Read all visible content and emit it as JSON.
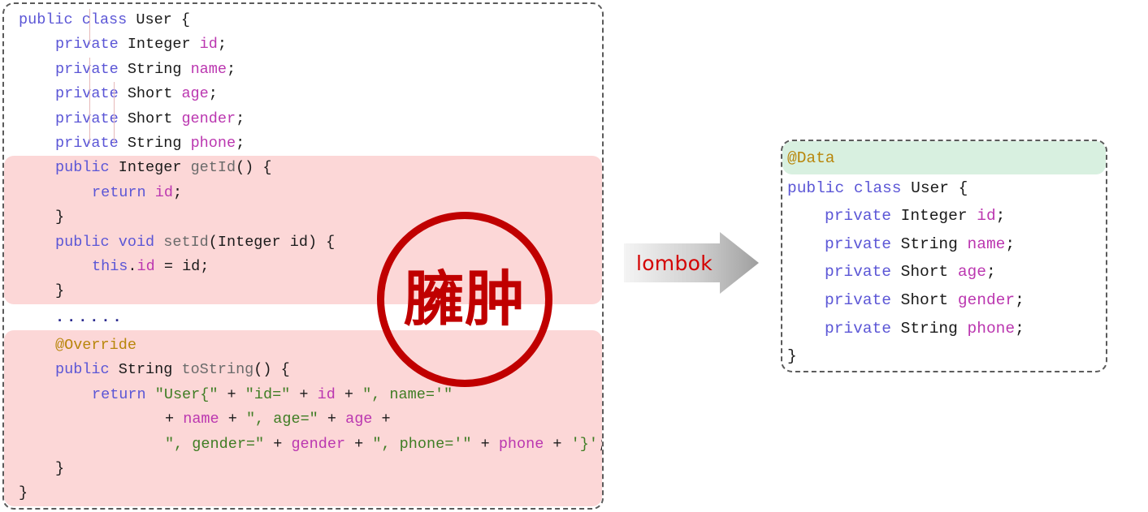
{
  "verbose_panel": {
    "name": "verbose-java-class",
    "highlight_color": "#fcd7d7",
    "lines": [
      {
        "indent": 0,
        "tokens": [
          {
            "t": "public",
            "c": "kw"
          },
          {
            "t": " ",
            "c": "pun"
          },
          {
            "t": "class",
            "c": "kw"
          },
          {
            "t": " ",
            "c": "pun"
          },
          {
            "t": "User",
            "c": "typ"
          },
          {
            "t": " {",
            "c": "pun"
          }
        ]
      },
      {
        "indent": 1,
        "tokens": [
          {
            "t": "private",
            "c": "kw"
          },
          {
            "t": " ",
            "c": "pun"
          },
          {
            "t": "Integer",
            "c": "typ"
          },
          {
            "t": " ",
            "c": "pun"
          },
          {
            "t": "id",
            "c": "fld"
          },
          {
            "t": ";",
            "c": "pun"
          }
        ]
      },
      {
        "indent": 1,
        "tokens": [
          {
            "t": "private",
            "c": "kw"
          },
          {
            "t": " ",
            "c": "pun"
          },
          {
            "t": "String",
            "c": "typ"
          },
          {
            "t": " ",
            "c": "pun"
          },
          {
            "t": "name",
            "c": "fld"
          },
          {
            "t": ";",
            "c": "pun"
          }
        ]
      },
      {
        "indent": 1,
        "tokens": [
          {
            "t": "private",
            "c": "kw"
          },
          {
            "t": " ",
            "c": "pun"
          },
          {
            "t": "Short",
            "c": "typ"
          },
          {
            "t": " ",
            "c": "pun"
          },
          {
            "t": "age",
            "c": "fld"
          },
          {
            "t": ";",
            "c": "pun"
          }
        ]
      },
      {
        "indent": 1,
        "tokens": [
          {
            "t": "private",
            "c": "kw"
          },
          {
            "t": " ",
            "c": "pun"
          },
          {
            "t": "Short",
            "c": "typ"
          },
          {
            "t": " ",
            "c": "pun"
          },
          {
            "t": "gender",
            "c": "fld"
          },
          {
            "t": ";",
            "c": "pun"
          }
        ]
      },
      {
        "indent": 1,
        "tokens": [
          {
            "t": "private",
            "c": "kw"
          },
          {
            "t": " ",
            "c": "pun"
          },
          {
            "t": "String",
            "c": "typ"
          },
          {
            "t": " ",
            "c": "pun"
          },
          {
            "t": "phone",
            "c": "fld"
          },
          {
            "t": ";",
            "c": "pun"
          }
        ]
      }
    ],
    "block_getters": [
      {
        "indent": 1,
        "tokens": [
          {
            "t": "public",
            "c": "kw"
          },
          {
            "t": " ",
            "c": "pun"
          },
          {
            "t": "Integer",
            "c": "typ"
          },
          {
            "t": " ",
            "c": "pun"
          },
          {
            "t": "getId",
            "c": "mth"
          },
          {
            "t": "() {",
            "c": "pun"
          }
        ]
      },
      {
        "indent": 2,
        "tokens": [
          {
            "t": "return",
            "c": "kw"
          },
          {
            "t": " ",
            "c": "pun"
          },
          {
            "t": "id",
            "c": "fld"
          },
          {
            "t": ";",
            "c": "pun"
          }
        ]
      },
      {
        "indent": 1,
        "tokens": [
          {
            "t": "}",
            "c": "pun"
          }
        ]
      },
      {
        "indent": 1,
        "tokens": [
          {
            "t": "public",
            "c": "kw"
          },
          {
            "t": " ",
            "c": "pun"
          },
          {
            "t": "void",
            "c": "kw"
          },
          {
            "t": " ",
            "c": "pun"
          },
          {
            "t": "setId",
            "c": "mth"
          },
          {
            "t": "(",
            "c": "pun"
          },
          {
            "t": "Integer",
            "c": "typ"
          },
          {
            "t": " ",
            "c": "pun"
          },
          {
            "t": "id",
            "c": "pun"
          },
          {
            "t": ") {",
            "c": "pun"
          }
        ]
      },
      {
        "indent": 2,
        "tokens": [
          {
            "t": "this",
            "c": "kw"
          },
          {
            "t": ".",
            "c": "pun"
          },
          {
            "t": "id",
            "c": "fld"
          },
          {
            "t": " = ",
            "c": "pun"
          },
          {
            "t": "id",
            "c": "pun"
          },
          {
            "t": ";",
            "c": "pun"
          }
        ]
      },
      {
        "indent": 1,
        "tokens": [
          {
            "t": "}",
            "c": "pun"
          }
        ]
      }
    ],
    "ellipsis_line": {
      "indent": 1,
      "tokens": [
        {
          "t": "......",
          "c": "dots"
        }
      ]
    },
    "block_tostring": [
      {
        "indent": 1,
        "tokens": [
          {
            "t": "@Override",
            "c": "ann"
          }
        ]
      },
      {
        "indent": 1,
        "tokens": [
          {
            "t": "public",
            "c": "kw"
          },
          {
            "t": " ",
            "c": "pun"
          },
          {
            "t": "String",
            "c": "typ"
          },
          {
            "t": " ",
            "c": "pun"
          },
          {
            "t": "toString",
            "c": "mth"
          },
          {
            "t": "() {",
            "c": "pun"
          }
        ]
      },
      {
        "indent": 2,
        "tokens": [
          {
            "t": "return",
            "c": "kw"
          },
          {
            "t": " ",
            "c": "pun"
          },
          {
            "t": "\"User{\"",
            "c": "str"
          },
          {
            "t": " + ",
            "c": "pun"
          },
          {
            "t": "\"id=\"",
            "c": "str"
          },
          {
            "t": " + ",
            "c": "pun"
          },
          {
            "t": "id",
            "c": "fld"
          },
          {
            "t": " + ",
            "c": "pun"
          },
          {
            "t": "\", name='\"",
            "c": "str"
          }
        ]
      },
      {
        "indent": 4,
        "tokens": [
          {
            "t": "+ ",
            "c": "pun"
          },
          {
            "t": "name",
            "c": "fld"
          },
          {
            "t": " + ",
            "c": "pun"
          },
          {
            "t": "\", age=\"",
            "c": "str"
          },
          {
            "t": " + ",
            "c": "pun"
          },
          {
            "t": "age",
            "c": "fld"
          },
          {
            "t": " +",
            "c": "pun"
          }
        ]
      },
      {
        "indent": 4,
        "tokens": [
          {
            "t": "\", gender=\"",
            "c": "str"
          },
          {
            "t": " + ",
            "c": "pun"
          },
          {
            "t": "gender",
            "c": "fld"
          },
          {
            "t": " + ",
            "c": "pun"
          },
          {
            "t": "\", phone='\"",
            "c": "str"
          },
          {
            "t": " + ",
            "c": "pun"
          },
          {
            "t": "phone",
            "c": "fld"
          },
          {
            "t": " + ",
            "c": "pun"
          },
          {
            "t": "'}'",
            "c": "str"
          },
          {
            "t": ";",
            "c": "pun"
          }
        ]
      },
      {
        "indent": 1,
        "tokens": [
          {
            "t": "}",
            "c": "pun"
          }
        ]
      },
      {
        "indent": 0,
        "tokens": [
          {
            "t": "}",
            "c": "pun"
          }
        ]
      }
    ]
  },
  "lombok_panel": {
    "name": "lombok-java-class",
    "highlight_color": "#d8f0e0",
    "annotation_line": {
      "indent": 0,
      "tokens": [
        {
          "t": "@Data",
          "c": "ann"
        }
      ]
    },
    "lines": [
      {
        "indent": 0,
        "tokens": [
          {
            "t": "public",
            "c": "kw"
          },
          {
            "t": " ",
            "c": "pun"
          },
          {
            "t": "class",
            "c": "kw"
          },
          {
            "t": " ",
            "c": "pun"
          },
          {
            "t": "User",
            "c": "typ"
          },
          {
            "t": " {",
            "c": "pun"
          }
        ]
      },
      {
        "indent": 1,
        "tokens": [
          {
            "t": "private",
            "c": "kw"
          },
          {
            "t": " ",
            "c": "pun"
          },
          {
            "t": "Integer",
            "c": "typ"
          },
          {
            "t": " ",
            "c": "pun"
          },
          {
            "t": "id",
            "c": "fld"
          },
          {
            "t": ";",
            "c": "pun"
          }
        ]
      },
      {
        "indent": 1,
        "tokens": [
          {
            "t": "private",
            "c": "kw"
          },
          {
            "t": " ",
            "c": "pun"
          },
          {
            "t": "String",
            "c": "typ"
          },
          {
            "t": " ",
            "c": "pun"
          },
          {
            "t": "name",
            "c": "fld"
          },
          {
            "t": ";",
            "c": "pun"
          }
        ]
      },
      {
        "indent": 1,
        "tokens": [
          {
            "t": "private",
            "c": "kw"
          },
          {
            "t": " ",
            "c": "pun"
          },
          {
            "t": "Short",
            "c": "typ"
          },
          {
            "t": " ",
            "c": "pun"
          },
          {
            "t": "age",
            "c": "fld"
          },
          {
            "t": ";",
            "c": "pun"
          }
        ]
      },
      {
        "indent": 1,
        "tokens": [
          {
            "t": "private",
            "c": "kw"
          },
          {
            "t": " ",
            "c": "pun"
          },
          {
            "t": "Short",
            "c": "typ"
          },
          {
            "t": " ",
            "c": "pun"
          },
          {
            "t": "gender",
            "c": "fld"
          },
          {
            "t": ";",
            "c": "pun"
          }
        ]
      },
      {
        "indent": 1,
        "tokens": [
          {
            "t": "private",
            "c": "kw"
          },
          {
            "t": " ",
            "c": "pun"
          },
          {
            "t": "String",
            "c": "typ"
          },
          {
            "t": " ",
            "c": "pun"
          },
          {
            "t": "phone",
            "c": "fld"
          },
          {
            "t": ";",
            "c": "pun"
          }
        ]
      },
      {
        "indent": 0,
        "tokens": [
          {
            "t": "}",
            "c": "pun"
          }
        ]
      }
    ]
  },
  "annotations": {
    "bloated_stamp": {
      "text": "臃肿",
      "color": "#c00000",
      "shape": "circle"
    },
    "arrow": {
      "label": "lombok",
      "label_color": "#d40000",
      "fill_start": "#f2f2f2",
      "fill_end": "#a6a6a6",
      "direction": "right"
    }
  }
}
